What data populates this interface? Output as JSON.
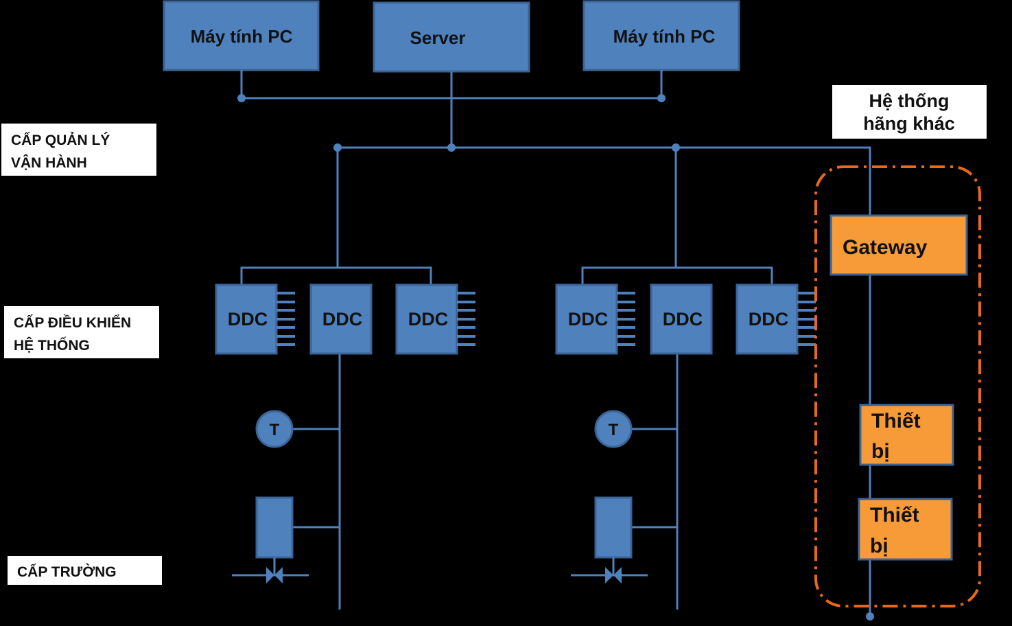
{
  "nodes": {
    "pc_left": "Máy tính PC",
    "server": "Server",
    "pc_right": "Máy tính PC",
    "ddc": "DDC",
    "sensor": "T",
    "gateway": "Gateway",
    "device_line1": "Thiết",
    "device_line2": "bị"
  },
  "labels": {
    "other_system": [
      "Hệ thống",
      "hãng khác"
    ],
    "management_level": [
      "CẤP QUẢN LÝ",
      "VẬN HÀNH"
    ],
    "control_level": [
      "CẤP ĐIỀU KHIỂN",
      "HỆ THỐNG"
    ],
    "field_level": "CẤP TRƯỜNG"
  },
  "colors": {
    "node_blue": "#4F81BD",
    "gateway_orange": "#F79A38",
    "boundary_orange": "#E8681C",
    "background": "#000000"
  }
}
